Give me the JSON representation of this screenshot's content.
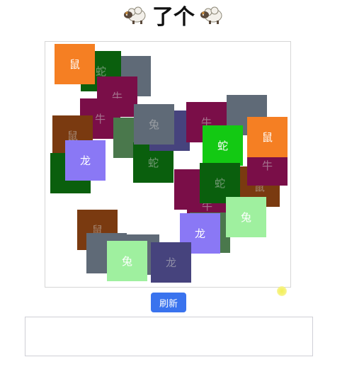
{
  "title": "了个",
  "refresh_label": "刷新",
  "colors": {
    "rat": "#f57f23",
    "ox": "#9c125c",
    "snake_dark": "#0d7a11",
    "snake_bright": "#13c913",
    "dragon": "#8a78f5",
    "rabbit": "#9ff09f",
    "gray": "#7a8898",
    "brown": "#9c4a14",
    "slate": "#5a56a0",
    "sage": "#5f9a62",
    "button": "#3a73ee"
  },
  "tiles": [
    {
      "label": "",
      "color": "#7a8898",
      "covered": true
    },
    {
      "label": "蛇",
      "color": "#0d7a11",
      "covered": true
    },
    {
      "label": "鼠",
      "color": "#f57f23",
      "covered": false
    },
    {
      "label": "牛",
      "color": "#9c125c",
      "covered": true
    },
    {
      "label": "牛",
      "color": "#9c125c",
      "covered": true
    },
    {
      "label": "鼠",
      "color": "#9c4a14",
      "covered": true
    },
    {
      "label": "",
      "color": "#5f9a62",
      "covered": true
    },
    {
      "label": "",
      "color": "#0d7a11",
      "covered": true
    },
    {
      "label": "龙",
      "color": "#8a78f5",
      "covered": false
    },
    {
      "label": "蛇",
      "color": "#0d7a11",
      "covered": true
    },
    {
      "label": "",
      "color": "#5a56a0",
      "covered": true
    },
    {
      "label": "兔",
      "color": "#7a8898",
      "covered": true
    },
    {
      "label": "牛",
      "color": "#9c125c",
      "covered": true
    },
    {
      "label": "",
      "color": "#7a8898",
      "covered": true
    },
    {
      "label": "蛇",
      "color": "#13c913",
      "covered": false
    },
    {
      "label": "鼠",
      "color": "#9c4a14",
      "covered": true
    },
    {
      "label": "牛",
      "color": "#9c125c",
      "covered": true
    },
    {
      "label": "鼠",
      "color": "#f57f23",
      "covered": false
    },
    {
      "label": "",
      "color": "#9c125c",
      "covered": true
    },
    {
      "label": "牛",
      "color": "#9c125c",
      "covered": true
    },
    {
      "label": "蛇",
      "color": "#0d7a11",
      "covered": true
    },
    {
      "label": "",
      "color": "#5f9a62",
      "covered": true
    },
    {
      "label": "兔",
      "color": "#9ff09f",
      "covered": false
    },
    {
      "label": "龙",
      "color": "#8a78f5",
      "covered": false
    },
    {
      "label": "鼠",
      "color": "#9c4a14",
      "covered": true
    },
    {
      "label": "",
      "color": "#7a8898",
      "covered": true
    },
    {
      "label": "",
      "color": "#7a8898",
      "covered": true
    },
    {
      "label": "龙",
      "color": "#5a56a0",
      "covered": true
    },
    {
      "label": "兔",
      "color": "#9ff09f",
      "covered": false
    }
  ]
}
